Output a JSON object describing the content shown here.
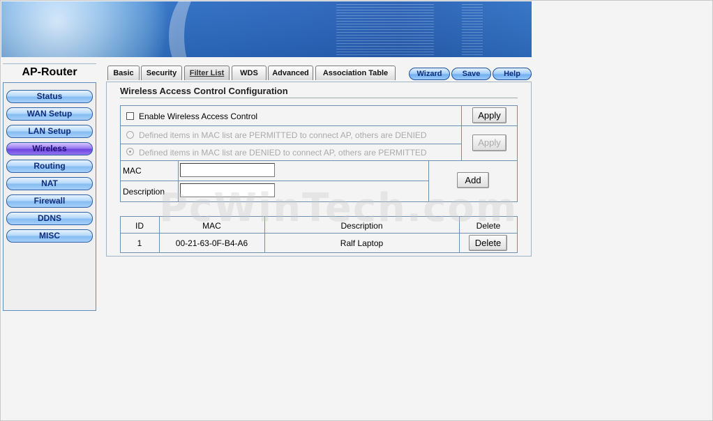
{
  "app": {
    "title": "AP-Router"
  },
  "sidebar": {
    "items": [
      {
        "label": "Status",
        "active": false
      },
      {
        "label": "WAN Setup",
        "active": false
      },
      {
        "label": "LAN Setup",
        "active": false
      },
      {
        "label": "Wireless",
        "active": true
      },
      {
        "label": "Routing",
        "active": false
      },
      {
        "label": "NAT",
        "active": false
      },
      {
        "label": "Firewall",
        "active": false
      },
      {
        "label": "DDNS",
        "active": false
      },
      {
        "label": "MISC",
        "active": false
      }
    ]
  },
  "tabs": [
    {
      "label": "Basic",
      "active": false
    },
    {
      "label": "Security",
      "active": false
    },
    {
      "label": "Filter List",
      "active": true
    },
    {
      "label": "WDS",
      "active": false
    },
    {
      "label": "Advanced",
      "active": false
    },
    {
      "label": "Association Table",
      "active": false
    }
  ],
  "top_buttons": {
    "wizard": "Wizard",
    "save": "Save",
    "help": "Help"
  },
  "section": {
    "title": "Wireless Access Control Configuration",
    "enable_label": "Enable Wireless Access Control",
    "enable_checked": false,
    "apply_label": "Apply",
    "apply2_label": "Apply",
    "permit_label": "Defined items in MAC list are PERMITTED to connect AP, others are DENIED",
    "deny_label": "Defined items in MAC list are DENIED to connect AP, others are PERMITTED",
    "selected_policy": "deny",
    "mac_label": "MAC",
    "mac_value": "",
    "desc_label": "Description",
    "desc_value": "",
    "add_label": "Add"
  },
  "mac_table": {
    "headers": {
      "id": "ID",
      "mac": "MAC",
      "description": "Description",
      "delete": "Delete"
    },
    "rows": [
      {
        "id": "1",
        "mac": "00-21-63-0F-B4-A6",
        "description": "Ralf Laptop",
        "delete_label": "Delete"
      }
    ]
  },
  "watermark": "PcWinTech.com",
  "colors": {
    "menu_blue": "#86bdf2",
    "menu_active": "#6f45e0",
    "border_blue": "#6f8fb0"
  }
}
